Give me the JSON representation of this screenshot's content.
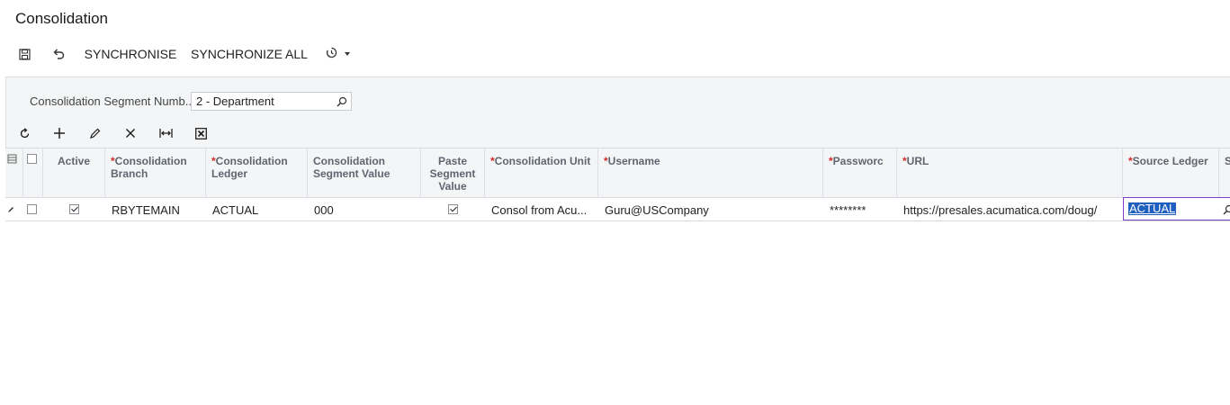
{
  "page": {
    "title": "Consolidation"
  },
  "toolbar": {
    "save_icon": "save-icon",
    "undo_icon": "undo-icon",
    "synchronise": "SYNCHRONISE",
    "synchronize_all": "SYNCHRONIZE ALL",
    "history_icon": "clock-icon"
  },
  "filter": {
    "label": "Consolidation Segment Numb...",
    "value": "2 - Department"
  },
  "grid_toolbar": [
    "refresh-icon",
    "plus-icon",
    "pencil-icon",
    "close-icon",
    "fit-columns-icon",
    "export-excel-icon"
  ],
  "grid": {
    "columns": {
      "active": "Active",
      "branch": "Consolidation Branch",
      "ledger": "Consolidation Ledger",
      "segment_value": "Consolidation Segment Value",
      "paste_segment": "Paste Segment Value",
      "unit": "Consolidation Unit",
      "username": "Username",
      "password": "Passworc",
      "url": "URL",
      "source_ledger": "Source Ledger",
      "next": "S"
    },
    "row": {
      "active": true,
      "branch": "RBYTEMAIN",
      "ledger": "ACTUAL",
      "segment_value": "000",
      "paste_segment": true,
      "unit": "Consol from Acu...",
      "username": "Guru@USCompany",
      "password": "********",
      "url": "https://presales.acumatica.com/doug/",
      "source_ledger": "ACTUAL"
    }
  },
  "colors": {
    "required": "#d12b2b",
    "selection": "#1f5fbf",
    "active_border": "#7d3cc9"
  }
}
